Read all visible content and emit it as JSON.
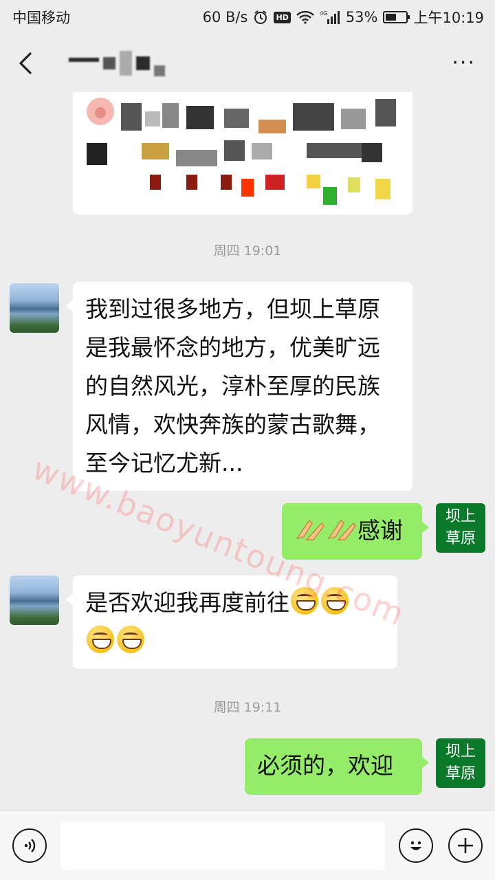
{
  "status_bar": {
    "carrier": "中国移动",
    "net_speed": "60 B/s",
    "hd_badge": "HD",
    "net_type": "4G",
    "battery": "53%",
    "battery_level": 0.53,
    "time": "上午10:19"
  },
  "header": {
    "back_icon": "chevron-left-icon",
    "more_label": "···"
  },
  "messages": [
    {
      "type": "time",
      "text": "周四 19:01"
    },
    {
      "type": "incoming",
      "text": "我到过很多地方，但坝上草原是我最怀念的地方，优美旷远的自然风光，淳朴至厚的民族风情，欢快奔族的蒙古歌舞，至今记忆尤新..."
    },
    {
      "type": "outgoing",
      "text": "感谢",
      "emoji": "clap-hands-icon"
    },
    {
      "type": "incoming",
      "text": "是否欢迎我再度前往",
      "emoji": "grin-icon"
    },
    {
      "type": "time",
      "text": "周四 19:11"
    },
    {
      "type": "outgoing",
      "text": "必须的，欢迎"
    }
  ],
  "self_avatar": {
    "line1": "坝上",
    "line2": "草原"
  },
  "watermark": "www.baoyuntoung.com",
  "input_bar": {
    "voice_icon": "voice-icon",
    "emoji_icon": "smiley-icon",
    "add_icon": "plus-icon"
  }
}
